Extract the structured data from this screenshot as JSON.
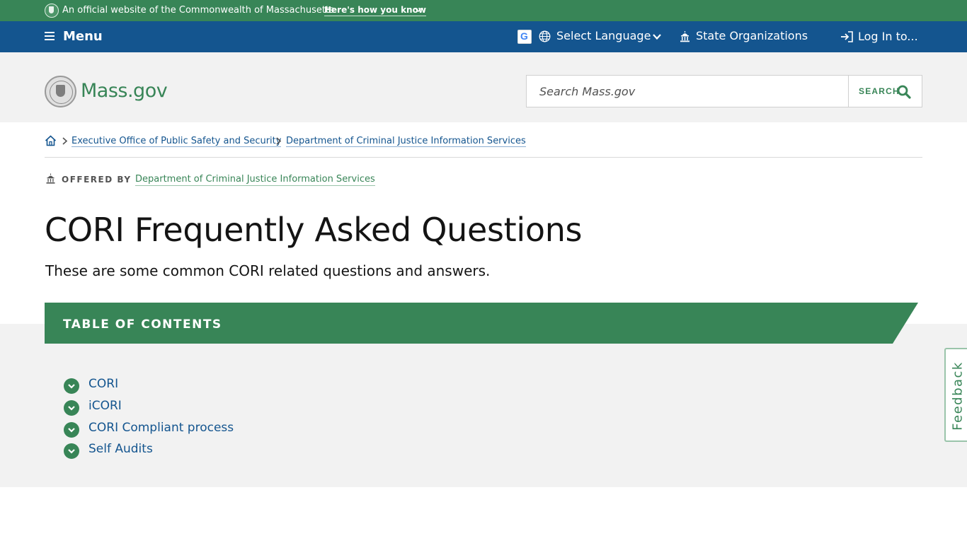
{
  "official_banner": {
    "text": "An official website of the Commonwealth of Massachusetts",
    "link": "Here's how you know"
  },
  "nav": {
    "menu": "Menu",
    "language": "Select Language",
    "organizations": "State Organizations",
    "login": "Log In to..."
  },
  "header": {
    "logo": "Mass.gov",
    "search_placeholder": "Search Mass.gov",
    "search_button": "SEARCH"
  },
  "breadcrumb": {
    "items": [
      "Executive Office of Public Safety and Security",
      "Department of Criminal Justice Information Services"
    ]
  },
  "offered_by": {
    "label": "OFFERED BY",
    "org": "Department of Criminal Justice Information Services"
  },
  "page": {
    "title": "CORI Frequently Asked Questions",
    "lede": "These are some common CORI related questions and answers."
  },
  "toc": {
    "title": "TABLE OF CONTENTS",
    "items": [
      "CORI",
      "iCORI",
      "CORI Compliant process",
      "Self Audits"
    ]
  },
  "feedback": {
    "label": "Feedback"
  },
  "colors": {
    "green": "#388557",
    "blue": "#14558f",
    "gray_bg": "#f2f2f2"
  },
  "icons": [
    "shield-seal-icon",
    "chevron-down-icon",
    "hamburger-icon",
    "google-translate-icon",
    "globe-icon",
    "capitol-building-icon",
    "login-icon",
    "search-icon",
    "home-icon",
    "chevron-right-icon",
    "toc-chevron-icon"
  ]
}
